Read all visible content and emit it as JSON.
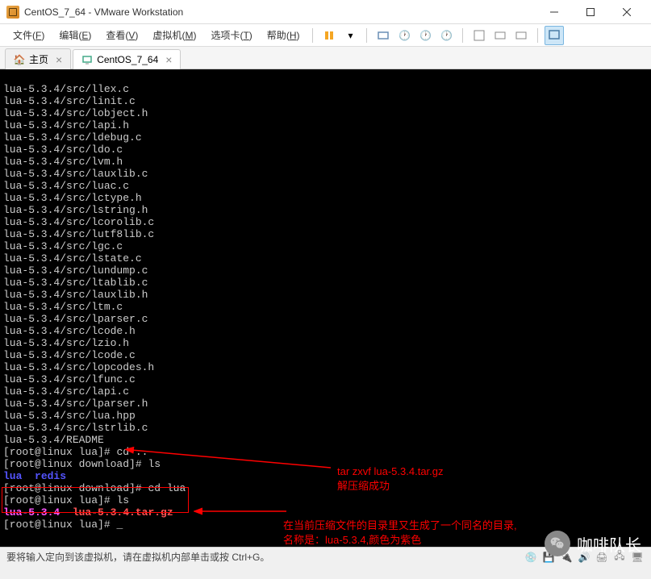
{
  "titlebar": {
    "title": "CentOS_7_64 - VMware Workstation"
  },
  "menubar": {
    "items": [
      {
        "label": "文件",
        "key": "F"
      },
      {
        "label": "编辑",
        "key": "E"
      },
      {
        "label": "查看",
        "key": "V"
      },
      {
        "label": "虚拟机",
        "key": "M"
      },
      {
        "label": "选项卡",
        "key": "T"
      },
      {
        "label": "帮助",
        "key": "H"
      }
    ]
  },
  "tabs": [
    {
      "label": "主页",
      "icon": "home"
    },
    {
      "label": "CentOS_7_64",
      "icon": "vm"
    }
  ],
  "terminal": {
    "output_lines": [
      "lua-5.3.4/src/llex.c",
      "lua-5.3.4/src/linit.c",
      "lua-5.3.4/src/lobject.h",
      "lua-5.3.4/src/lapi.h",
      "lua-5.3.4/src/ldebug.c",
      "lua-5.3.4/src/ldo.c",
      "lua-5.3.4/src/lvm.h",
      "lua-5.3.4/src/lauxlib.c",
      "lua-5.3.4/src/luac.c",
      "lua-5.3.4/src/lctype.h",
      "lua-5.3.4/src/lstring.h",
      "lua-5.3.4/src/lcorolib.c",
      "lua-5.3.4/src/lutf8lib.c",
      "lua-5.3.4/src/lgc.c",
      "lua-5.3.4/src/lstate.c",
      "lua-5.3.4/src/lundump.c",
      "lua-5.3.4/src/ltablib.c",
      "lua-5.3.4/src/lauxlib.h",
      "lua-5.3.4/src/ltm.c",
      "lua-5.3.4/src/lparser.c",
      "lua-5.3.4/src/lcode.h",
      "lua-5.3.4/src/lzio.h",
      "lua-5.3.4/src/lcode.c",
      "lua-5.3.4/src/lopcodes.h",
      "lua-5.3.4/src/lfunc.c",
      "lua-5.3.4/src/lapi.c",
      "lua-5.3.4/src/lparser.h",
      "lua-5.3.4/src/lua.hpp",
      "lua-5.3.4/src/lstrlib.c",
      "lua-5.3.4/README"
    ],
    "prompts": [
      {
        "prompt": "[root@linux lua]# ",
        "cmd": "cd .."
      },
      {
        "prompt": "[root@linux download]# ",
        "cmd": "ls"
      }
    ],
    "ls_out1": {
      "dirs": [
        "lua",
        "redis"
      ]
    },
    "prompt3": {
      "prompt": "[root@linux download]# ",
      "cmd": "cd lua"
    },
    "prompt4": {
      "prompt": "[root@linux lua]# ",
      "cmd": "ls"
    },
    "ls_out2": {
      "dir": "lua-5.3.4",
      "archive": "lua-5.3.4.tar.gz"
    },
    "prompt5": {
      "prompt": "[root@linux lua]# ",
      "cursor": "_"
    }
  },
  "annotations": {
    "top": {
      "line1": "tar zxvf lua-5.3.4.tar.gz",
      "line2": "解压缩成功"
    },
    "bottom": {
      "line1": "在当前压缩文件的目录里又生成了一个同名的目录,",
      "line2": "名称是：lua-5.3.4,颜色为紫色"
    }
  },
  "statusbar": {
    "text": "要将输入定向到该虚拟机，请在虚拟机内部单击或按 Ctrl+G。"
  },
  "watermark": {
    "text": "咖啡队长"
  }
}
